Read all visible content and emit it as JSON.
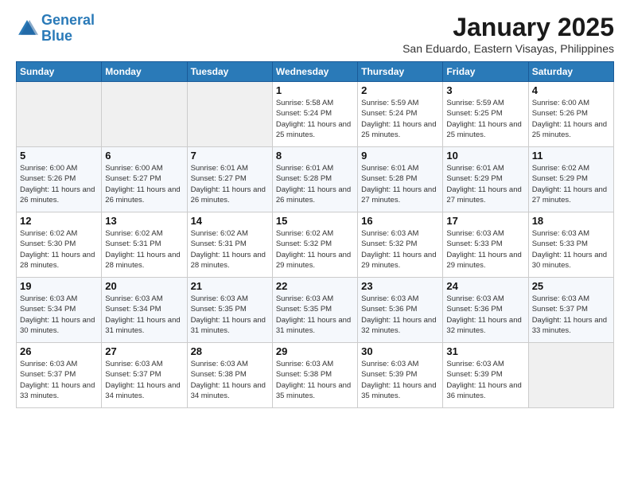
{
  "logo": {
    "line1": "General",
    "line2": "Blue"
  },
  "title": "January 2025",
  "location": "San Eduardo, Eastern Visayas, Philippines",
  "weekdays": [
    "Sunday",
    "Monday",
    "Tuesday",
    "Wednesday",
    "Thursday",
    "Friday",
    "Saturday"
  ],
  "weeks": [
    [
      {
        "day": "",
        "sunrise": "",
        "sunset": "",
        "daylight": ""
      },
      {
        "day": "",
        "sunrise": "",
        "sunset": "",
        "daylight": ""
      },
      {
        "day": "",
        "sunrise": "",
        "sunset": "",
        "daylight": ""
      },
      {
        "day": "1",
        "sunrise": "Sunrise: 5:58 AM",
        "sunset": "Sunset: 5:24 PM",
        "daylight": "Daylight: 11 hours and 25 minutes."
      },
      {
        "day": "2",
        "sunrise": "Sunrise: 5:59 AM",
        "sunset": "Sunset: 5:24 PM",
        "daylight": "Daylight: 11 hours and 25 minutes."
      },
      {
        "day": "3",
        "sunrise": "Sunrise: 5:59 AM",
        "sunset": "Sunset: 5:25 PM",
        "daylight": "Daylight: 11 hours and 25 minutes."
      },
      {
        "day": "4",
        "sunrise": "Sunrise: 6:00 AM",
        "sunset": "Sunset: 5:26 PM",
        "daylight": "Daylight: 11 hours and 25 minutes."
      }
    ],
    [
      {
        "day": "5",
        "sunrise": "Sunrise: 6:00 AM",
        "sunset": "Sunset: 5:26 PM",
        "daylight": "Daylight: 11 hours and 26 minutes."
      },
      {
        "day": "6",
        "sunrise": "Sunrise: 6:00 AM",
        "sunset": "Sunset: 5:27 PM",
        "daylight": "Daylight: 11 hours and 26 minutes."
      },
      {
        "day": "7",
        "sunrise": "Sunrise: 6:01 AM",
        "sunset": "Sunset: 5:27 PM",
        "daylight": "Daylight: 11 hours and 26 minutes."
      },
      {
        "day": "8",
        "sunrise": "Sunrise: 6:01 AM",
        "sunset": "Sunset: 5:28 PM",
        "daylight": "Daylight: 11 hours and 26 minutes."
      },
      {
        "day": "9",
        "sunrise": "Sunrise: 6:01 AM",
        "sunset": "Sunset: 5:28 PM",
        "daylight": "Daylight: 11 hours and 27 minutes."
      },
      {
        "day": "10",
        "sunrise": "Sunrise: 6:01 AM",
        "sunset": "Sunset: 5:29 PM",
        "daylight": "Daylight: 11 hours and 27 minutes."
      },
      {
        "day": "11",
        "sunrise": "Sunrise: 6:02 AM",
        "sunset": "Sunset: 5:29 PM",
        "daylight": "Daylight: 11 hours and 27 minutes."
      }
    ],
    [
      {
        "day": "12",
        "sunrise": "Sunrise: 6:02 AM",
        "sunset": "Sunset: 5:30 PM",
        "daylight": "Daylight: 11 hours and 28 minutes."
      },
      {
        "day": "13",
        "sunrise": "Sunrise: 6:02 AM",
        "sunset": "Sunset: 5:31 PM",
        "daylight": "Daylight: 11 hours and 28 minutes."
      },
      {
        "day": "14",
        "sunrise": "Sunrise: 6:02 AM",
        "sunset": "Sunset: 5:31 PM",
        "daylight": "Daylight: 11 hours and 28 minutes."
      },
      {
        "day": "15",
        "sunrise": "Sunrise: 6:02 AM",
        "sunset": "Sunset: 5:32 PM",
        "daylight": "Daylight: 11 hours and 29 minutes."
      },
      {
        "day": "16",
        "sunrise": "Sunrise: 6:03 AM",
        "sunset": "Sunset: 5:32 PM",
        "daylight": "Daylight: 11 hours and 29 minutes."
      },
      {
        "day": "17",
        "sunrise": "Sunrise: 6:03 AM",
        "sunset": "Sunset: 5:33 PM",
        "daylight": "Daylight: 11 hours and 29 minutes."
      },
      {
        "day": "18",
        "sunrise": "Sunrise: 6:03 AM",
        "sunset": "Sunset: 5:33 PM",
        "daylight": "Daylight: 11 hours and 30 minutes."
      }
    ],
    [
      {
        "day": "19",
        "sunrise": "Sunrise: 6:03 AM",
        "sunset": "Sunset: 5:34 PM",
        "daylight": "Daylight: 11 hours and 30 minutes."
      },
      {
        "day": "20",
        "sunrise": "Sunrise: 6:03 AM",
        "sunset": "Sunset: 5:34 PM",
        "daylight": "Daylight: 11 hours and 31 minutes."
      },
      {
        "day": "21",
        "sunrise": "Sunrise: 6:03 AM",
        "sunset": "Sunset: 5:35 PM",
        "daylight": "Daylight: 11 hours and 31 minutes."
      },
      {
        "day": "22",
        "sunrise": "Sunrise: 6:03 AM",
        "sunset": "Sunset: 5:35 PM",
        "daylight": "Daylight: 11 hours and 31 minutes."
      },
      {
        "day": "23",
        "sunrise": "Sunrise: 6:03 AM",
        "sunset": "Sunset: 5:36 PM",
        "daylight": "Daylight: 11 hours and 32 minutes."
      },
      {
        "day": "24",
        "sunrise": "Sunrise: 6:03 AM",
        "sunset": "Sunset: 5:36 PM",
        "daylight": "Daylight: 11 hours and 32 minutes."
      },
      {
        "day": "25",
        "sunrise": "Sunrise: 6:03 AM",
        "sunset": "Sunset: 5:37 PM",
        "daylight": "Daylight: 11 hours and 33 minutes."
      }
    ],
    [
      {
        "day": "26",
        "sunrise": "Sunrise: 6:03 AM",
        "sunset": "Sunset: 5:37 PM",
        "daylight": "Daylight: 11 hours and 33 minutes."
      },
      {
        "day": "27",
        "sunrise": "Sunrise: 6:03 AM",
        "sunset": "Sunset: 5:37 PM",
        "daylight": "Daylight: 11 hours and 34 minutes."
      },
      {
        "day": "28",
        "sunrise": "Sunrise: 6:03 AM",
        "sunset": "Sunset: 5:38 PM",
        "daylight": "Daylight: 11 hours and 34 minutes."
      },
      {
        "day": "29",
        "sunrise": "Sunrise: 6:03 AM",
        "sunset": "Sunset: 5:38 PM",
        "daylight": "Daylight: 11 hours and 35 minutes."
      },
      {
        "day": "30",
        "sunrise": "Sunrise: 6:03 AM",
        "sunset": "Sunset: 5:39 PM",
        "daylight": "Daylight: 11 hours and 35 minutes."
      },
      {
        "day": "31",
        "sunrise": "Sunrise: 6:03 AM",
        "sunset": "Sunset: 5:39 PM",
        "daylight": "Daylight: 11 hours and 36 minutes."
      },
      {
        "day": "",
        "sunrise": "",
        "sunset": "",
        "daylight": ""
      }
    ]
  ]
}
